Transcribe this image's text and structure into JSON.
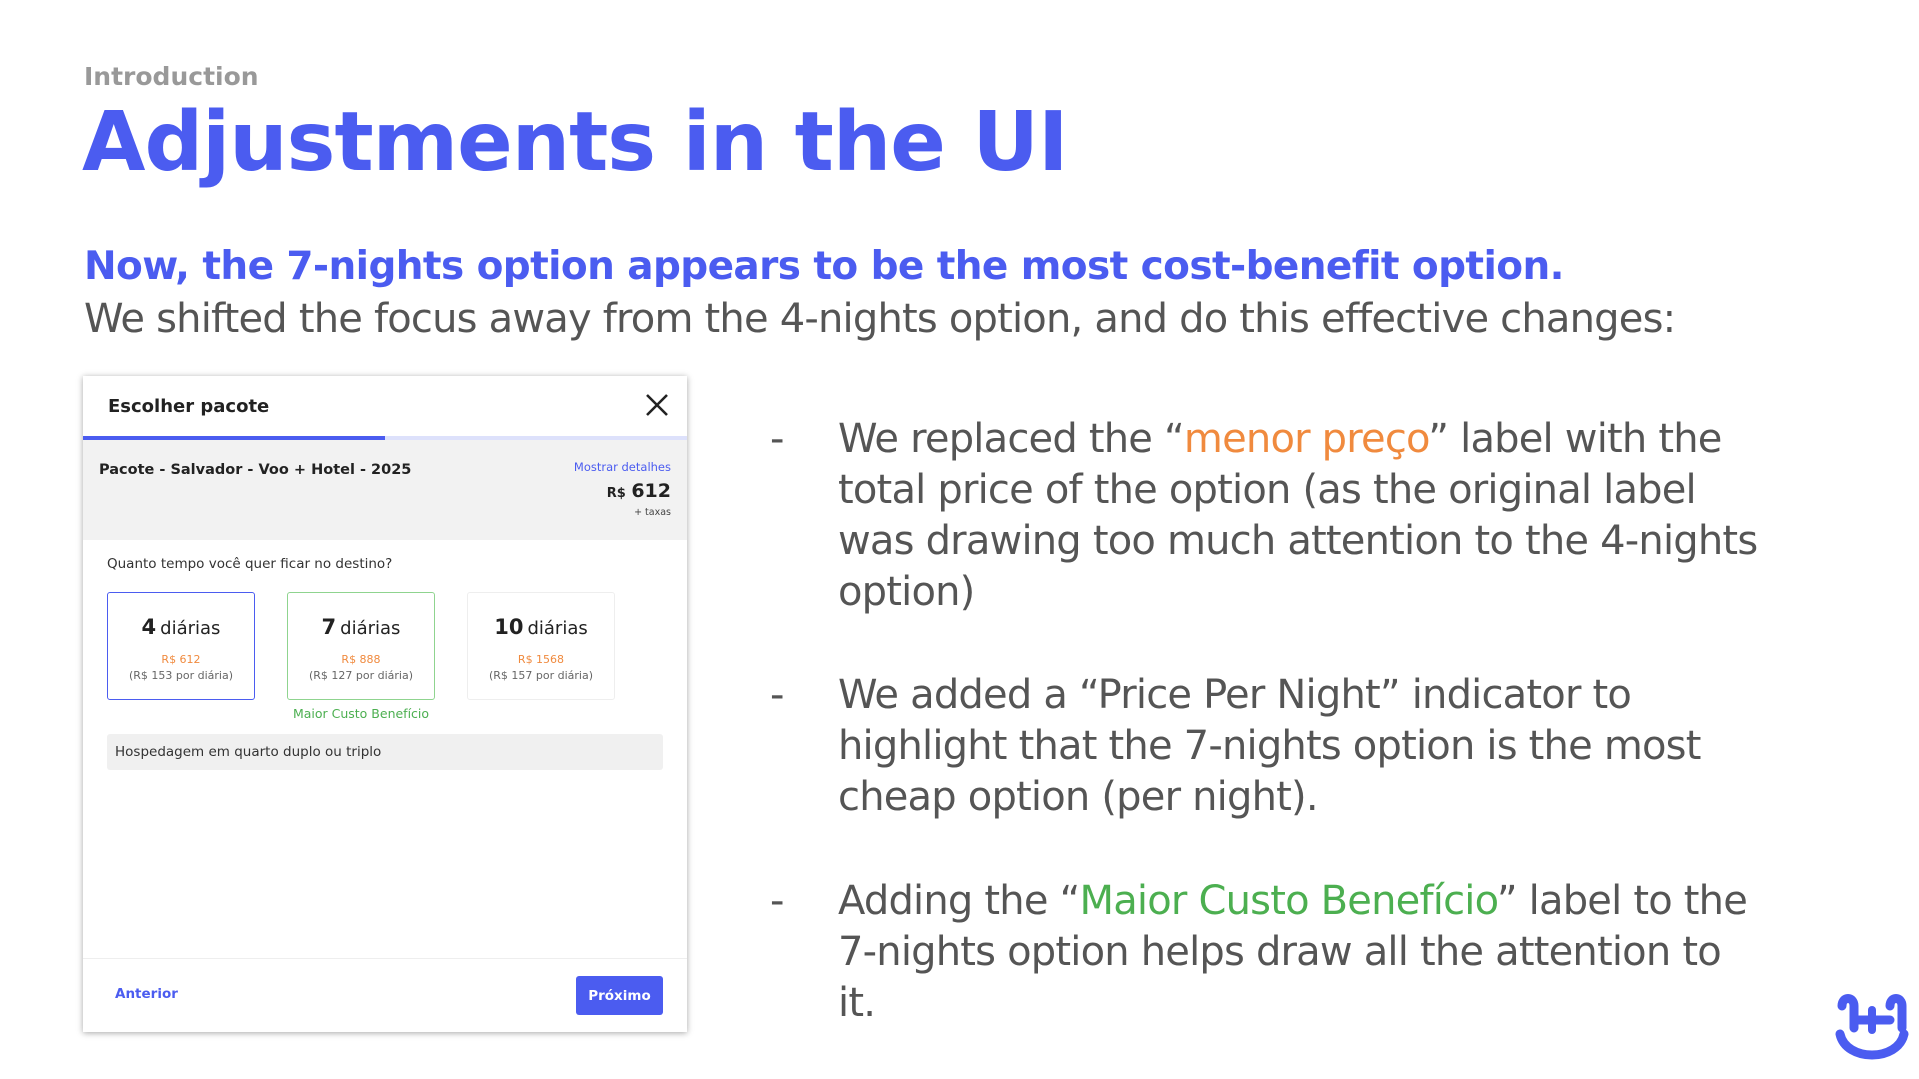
{
  "slide": {
    "section": "Introduction",
    "title": "Adjustments in the UI",
    "headline": "Now, the 7-nights option appears to be the most cost-benefit option.",
    "subline": "We shifted the focus away from the 4-nights option, and do this effective changes:"
  },
  "modal": {
    "title": "Escolher pacote",
    "progress_fraction": 0.5,
    "package_name": "Pacote - Salvador - Voo + Hotel - 2025",
    "details_link": "Mostrar detalhes",
    "currency": "R$",
    "total_price": "612",
    "taxes_note": "+ taxas",
    "question": "Quanto tempo você quer ficar no destino?",
    "options": [
      {
        "days": "4",
        "unit": "diárias",
        "price": "R$ 612",
        "per_night": "(R$ 153 por diária)"
      },
      {
        "days": "7",
        "unit": "diárias",
        "price": "R$ 888",
        "per_night": "(R$ 127 por diária)"
      },
      {
        "days": "10",
        "unit": "diárias",
        "price": "R$ 1568",
        "per_night": "(R$ 157 por diária)"
      }
    ],
    "best_value_label": "Maior Custo Benefício",
    "room_info": "Hospedagem em quarto duplo ou triplo",
    "prev_label": "Anterior",
    "next_label": "Próximo"
  },
  "bullets": [
    {
      "dash": "-",
      "before": "We replaced the “",
      "highlight": "menor preço",
      "after": "” label with the total price of the option (as the original label was drawing too much attention to the 4-nights option)"
    },
    {
      "dash": "-",
      "text": "We added a “Price Per Night” indicator to highlight that the 7-nights option is the most cheap option (per night)."
    },
    {
      "dash": "-",
      "before": "Adding the “",
      "highlight": "Maior Custo Benefício",
      "after": "” label to the 7-nights option helps draw all the attention to it."
    }
  ],
  "colors": {
    "brand_blue": "#4b5cf0",
    "price_orange": "#f08a3e",
    "benefit_green": "#4caf50"
  },
  "icons": {
    "close": "close-icon",
    "logo": "brand-logo-icon"
  }
}
